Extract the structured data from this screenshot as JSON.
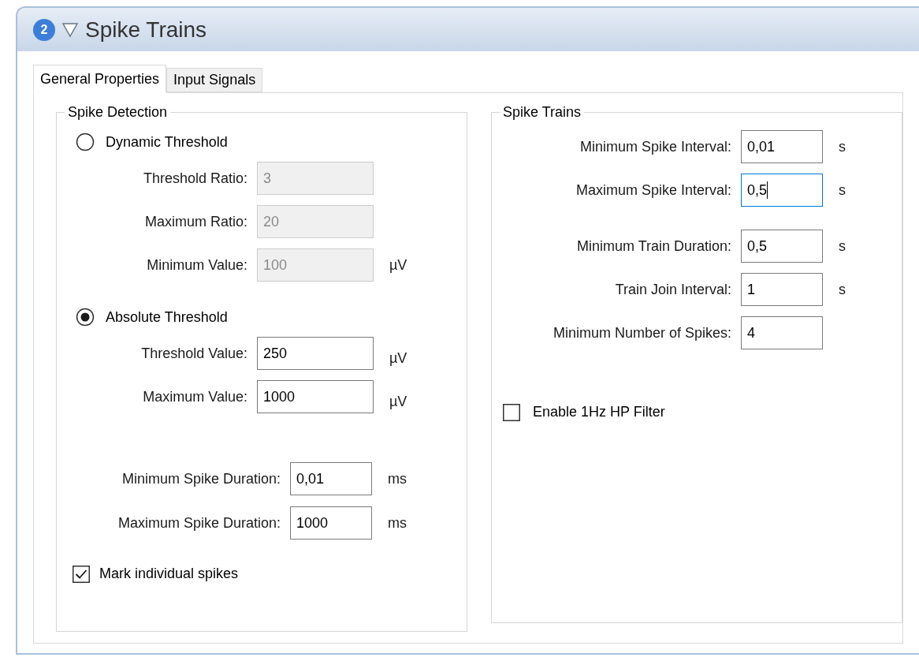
{
  "panel": {
    "badge": "2",
    "title": "Spike Trains",
    "expanded": true
  },
  "tabs": [
    {
      "label": "General Properties",
      "selected": true
    },
    {
      "label": "Input Signals",
      "selected": false
    }
  ],
  "spike_detection": {
    "title": "Spike Detection",
    "modes": [
      {
        "label": "Dynamic Threshold",
        "selected": false,
        "fields": [
          {
            "label": "Threshold Ratio:",
            "value": "3",
            "disabled": true
          },
          {
            "label": "Maximum Ratio:",
            "value": "20",
            "disabled": true
          },
          {
            "label": "Minimum Value:",
            "value": "100",
            "unit": "µV",
            "disabled": true
          }
        ]
      },
      {
        "label": "Absolute Threshold",
        "selected": true,
        "fields": [
          {
            "label": "Threshold Value:",
            "value": "250",
            "unit": "µV",
            "disabled": false
          },
          {
            "label": "Maximum Value:",
            "value": "1000",
            "unit": "µV",
            "disabled": false
          }
        ]
      }
    ],
    "durations": [
      {
        "label": "Minimum Spike Duration:",
        "value": "0,01",
        "unit": "ms"
      },
      {
        "label": "Maximum Spike Duration:",
        "value": "1000",
        "unit": "ms"
      }
    ],
    "mark_spikes": {
      "label": "Mark individual spikes",
      "checked": true
    }
  },
  "spike_trains": {
    "title": "Spike Trains",
    "fields": [
      {
        "label": "Minimum Spike Interval:",
        "value": "0,01",
        "unit": "s",
        "focused": false
      },
      {
        "label": "Maximum Spike Interval:",
        "value": "0,5",
        "unit": "s",
        "focused": true
      },
      {
        "label": "Minimum Train Duration:",
        "value": "0,5",
        "unit": "s",
        "focused": false
      },
      {
        "label": "Train Join Interval:",
        "value": "1",
        "unit": "s",
        "focused": false
      },
      {
        "label": "Minimum Number of Spikes:",
        "value": "4",
        "focused": false
      }
    ],
    "hp_filter": {
      "label": "Enable 1Hz HP Filter",
      "checked": false
    }
  }
}
